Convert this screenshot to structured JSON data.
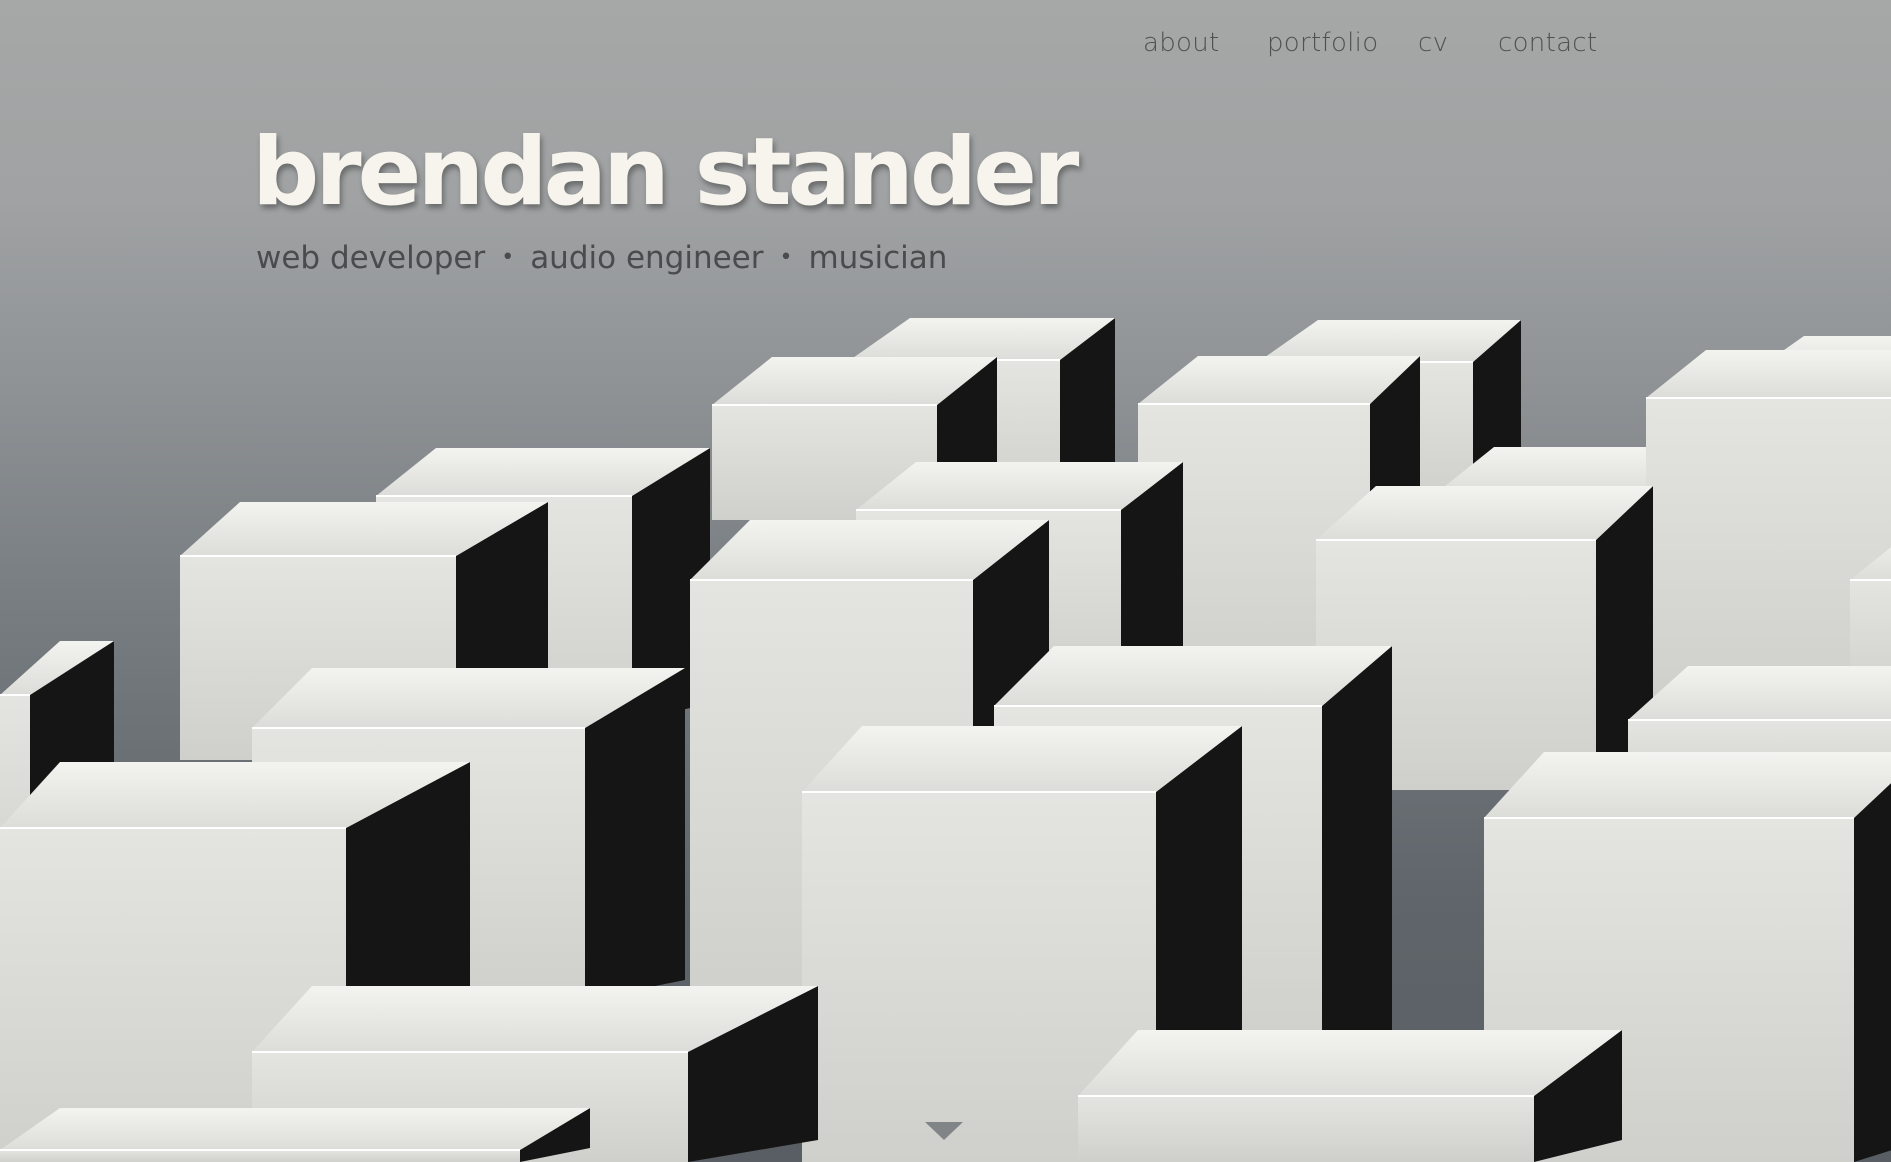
{
  "nav": {
    "items": [
      {
        "label": "about"
      },
      {
        "label": "portfolio"
      },
      {
        "label": "cv"
      },
      {
        "label": "contact"
      }
    ]
  },
  "hero": {
    "title": "brendan stander",
    "roles": [
      "web developer",
      "audio engineer",
      "musician"
    ],
    "separator": "•"
  },
  "icons": {
    "scroll_down": "triangle-down-icon"
  },
  "colors": {
    "title": "#f6f4ec",
    "subtitle": "#4a4b4c",
    "nav": "#4f5050",
    "cube_face": "#e6e6e2",
    "cube_shadow": "#141414"
  }
}
